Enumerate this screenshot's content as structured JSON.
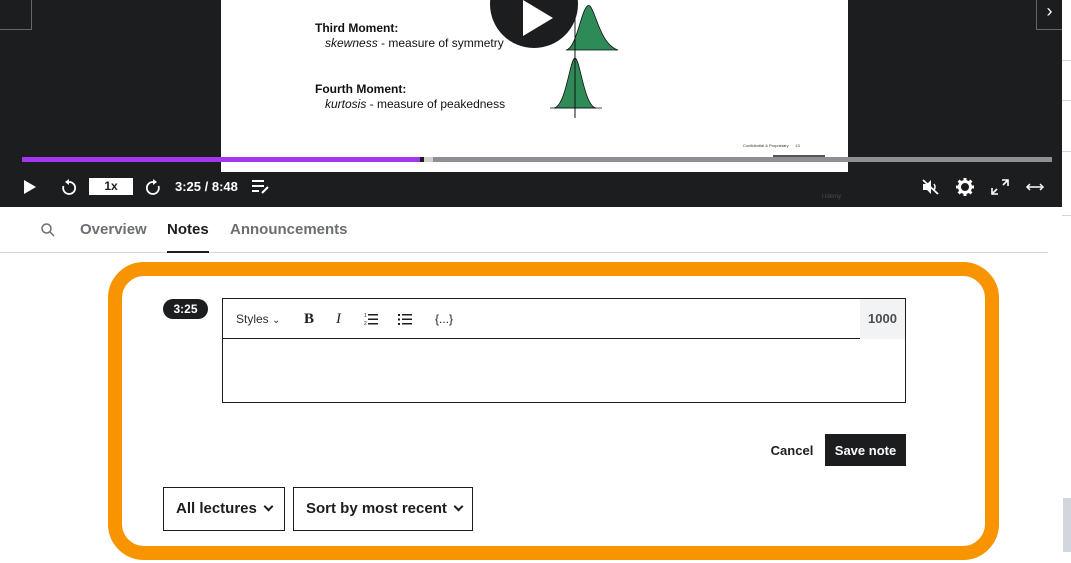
{
  "slide": {
    "third_title": "Third Moment:",
    "third_term": "skewness",
    "third_desc": " - measure of symmetry",
    "fourth_title": "Fourth Moment:",
    "fourth_term": "kurtosis",
    "fourth_desc": " - measure of peakedness",
    "footer": "Confidential & Proprietary",
    "page_number": "13",
    "watermark": "Udemy"
  },
  "player": {
    "speed": "1x",
    "time": "3:25 / 8:48",
    "progress_fraction": 0.389,
    "icons": [
      "play-icon",
      "rewind-icon",
      "forward-icon",
      "transcript-icon",
      "mute-icon",
      "settings-icon",
      "fullscreen-icon",
      "expand-icon"
    ],
    "accent_color": "#a435f0"
  },
  "tabs": {
    "items": [
      {
        "label": "Overview"
      },
      {
        "label": "Notes"
      },
      {
        "label": "Announcements"
      }
    ],
    "active": "Notes"
  },
  "note": {
    "timestamp": "3:25",
    "styles_label": "Styles",
    "bold_label": "B",
    "italic_label": "I",
    "code_label": "{...}",
    "char_count": "1000",
    "text": "",
    "cancel_label": "Cancel",
    "save_label": "Save note"
  },
  "filters": {
    "lectures_label": "All lectures",
    "sort_label": "Sort by most recent"
  },
  "highlight_color": "#f79400"
}
